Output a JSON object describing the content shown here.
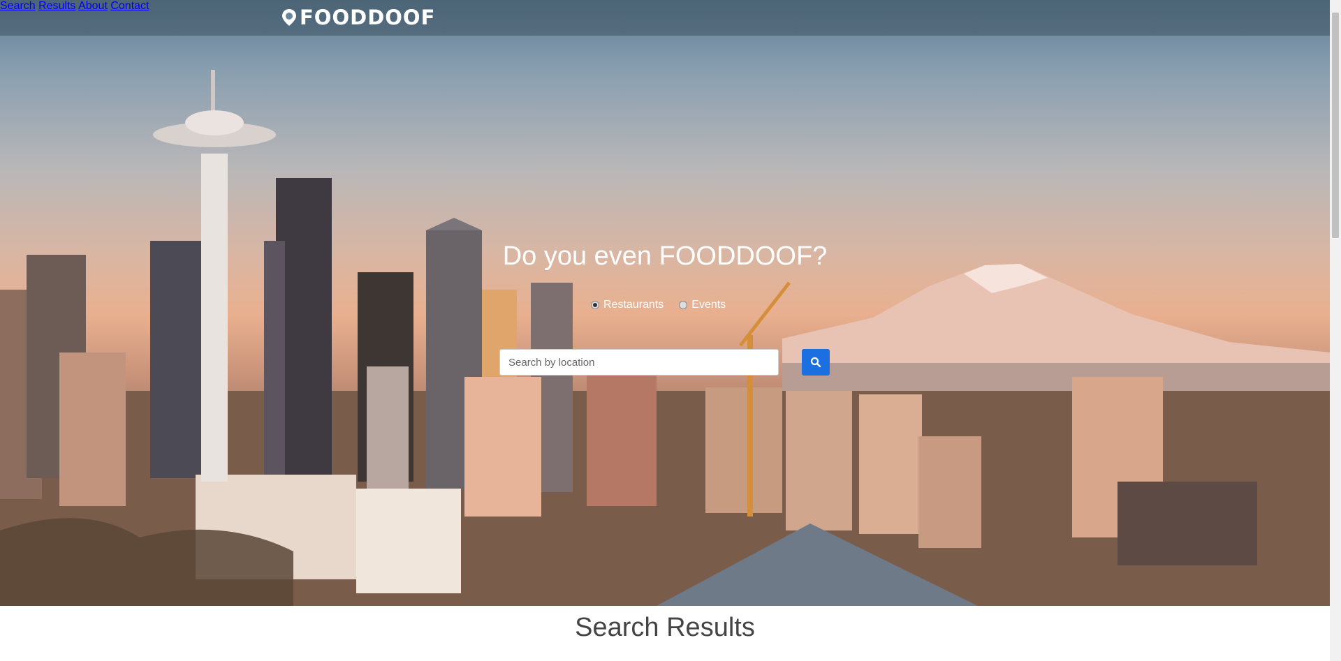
{
  "brand": {
    "name": "FOODDOOF",
    "icon": "location-pin-icon"
  },
  "nav": {
    "items": [
      "Search",
      "Results",
      "About",
      "Contact"
    ]
  },
  "hero": {
    "headline": "Do you even FOODDOOF?",
    "radios": [
      {
        "label": "Restaurants",
        "checked": true
      },
      {
        "label": "Events",
        "checked": false
      }
    ],
    "search": {
      "placeholder": "Search by location",
      "value": "",
      "button_icon": "search-icon"
    }
  },
  "results": {
    "heading": "Search Results"
  },
  "colors": {
    "accent": "#1b6fe0",
    "navbar": "#3c505f"
  }
}
